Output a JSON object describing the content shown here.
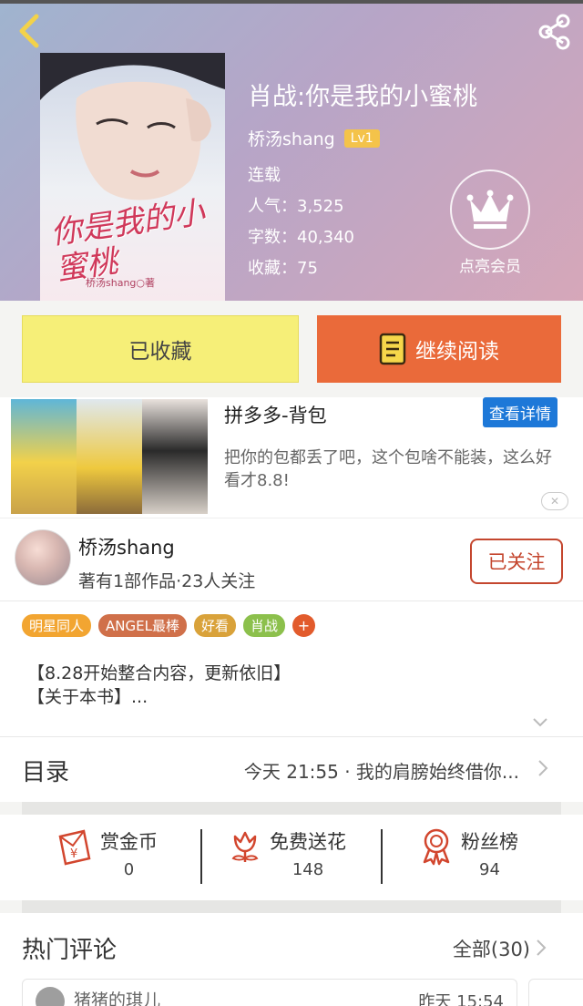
{
  "header": {
    "book_title": "肖战:你是我的小蜜桃",
    "author": "桥汤shang",
    "level": "Lv1",
    "status": "连载",
    "popularity": "人气：3,525",
    "word_count": "字数：40,340",
    "favorites": "收藏：75",
    "vip_label": "点亮会员",
    "cover_title": "你是我的小蜜桃",
    "cover_author": "桥汤shang○著"
  },
  "actions": {
    "collected_label": "已收藏",
    "read_label": "继续阅读"
  },
  "ad": {
    "title": "拼多多-背包",
    "detail_label": "查看详情",
    "description": "把你的包都丢了吧，这个包啥不能装，这么好看才8.8!"
  },
  "author_card": {
    "name": "桥汤shang",
    "sub": "著有1部作品·23人关注",
    "follow_label": "已关注"
  },
  "tags": [
    {
      "label": "明星同人",
      "color": "#f2a531"
    },
    {
      "label": "ANGEL最棒",
      "color": "#d0704a"
    },
    {
      "label": "好看",
      "color": "#d9a23a"
    },
    {
      "label": "肖战",
      "color": "#8cc04c"
    }
  ],
  "tag_add": "+",
  "intro": {
    "line1": "【8.28开始整合内容，更新依旧】",
    "line2": "【关于本书】..."
  },
  "toc": {
    "label": "目录",
    "latest": "今天 21:55 · 我的肩膀始终借你..."
  },
  "stats": [
    {
      "label": "赏金币",
      "value": "0"
    },
    {
      "label": "免费送花",
      "value": "148"
    },
    {
      "label": "粉丝榜",
      "value": "94"
    }
  ],
  "comments": {
    "title": "热门评论",
    "all_label": "全部(30)",
    "first_user": "猪猪的琪儿",
    "first_time": "昨天 15:54"
  },
  "colors": {
    "accent_orange": "#ea6a3a",
    "collected_yellow": "#f6ef78",
    "follow_red": "#c4462e",
    "detail_blue": "#1d78d8"
  }
}
